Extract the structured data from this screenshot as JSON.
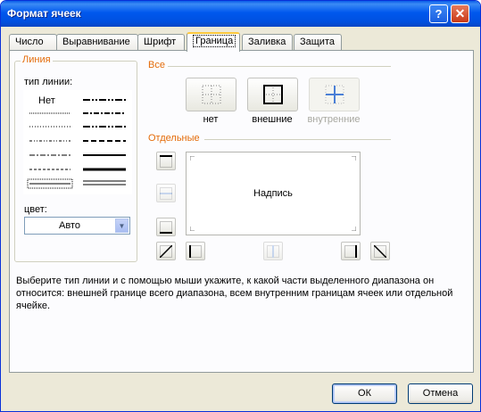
{
  "window": {
    "title": "Формат ячеек",
    "help_glyph": "?",
    "close_glyph": "✕"
  },
  "tabs": [
    {
      "label": "Число"
    },
    {
      "label": "Выравнивание"
    },
    {
      "label": "Шрифт"
    },
    {
      "label": "Граница",
      "active": true
    },
    {
      "label": "Заливка"
    },
    {
      "label": "Защита"
    }
  ],
  "line": {
    "group_label": "Линия",
    "style_label": "тип линии:",
    "none_label": "Нет",
    "color_label": "цвет:",
    "color_value": "Авто"
  },
  "presets": {
    "group_label": "Все",
    "items": [
      {
        "label": "нет",
        "icon": "no-border-icon",
        "enabled": true
      },
      {
        "label": "внешние",
        "icon": "outline-border-icon",
        "enabled": true
      },
      {
        "label": "внутренние",
        "icon": "inside-border-icon",
        "enabled": false
      }
    ]
  },
  "border": {
    "group_label": "Отдельные",
    "preview_text": "Надпись"
  },
  "hint_text": "Выберите тип линии и с помощью мыши укажите, к какой части выделенного диапазона он относится: внешней границе всего диапазона, всем внутренним границам ячеек или отдельной ячейке.",
  "buttons": {
    "ok": "ОК",
    "cancel": "Отмена"
  },
  "colors": {
    "title_bar": "#0058ee",
    "group_label": "#e46c0a",
    "dialog_bg": "#ece9d8",
    "panel_bg": "#fcfcfe",
    "inside_border_accent": "#4a7fd6"
  }
}
